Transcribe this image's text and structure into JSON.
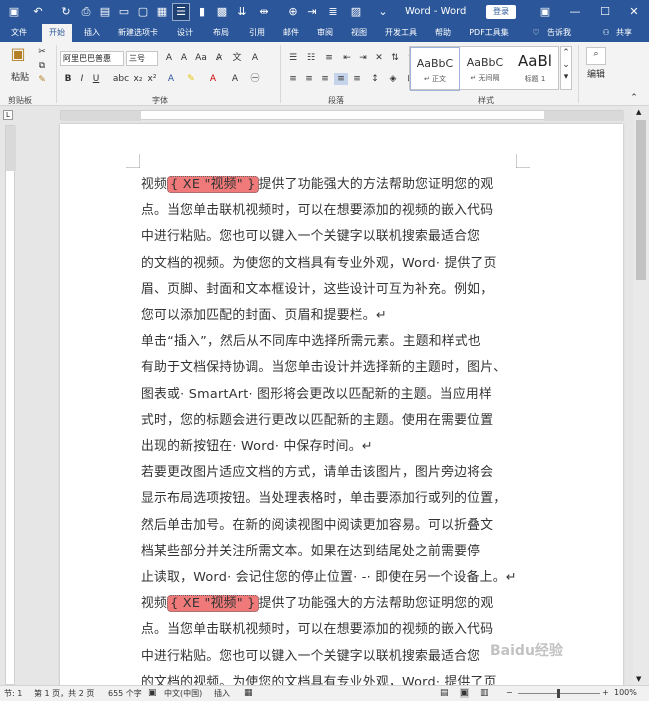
{
  "titlebar": {
    "title": "Word - Word",
    "login_label": "登录",
    "colors": {
      "brand": "#2b579a"
    }
  },
  "tabs": [
    "文件",
    "开始",
    "插入",
    "新建选项卡",
    "设计",
    "布局",
    "引用",
    "邮件",
    "审阅",
    "视图",
    "开发工具",
    "帮助",
    "PDF工具集"
  ],
  "active_tab": "开始",
  "tellme": "告诉我",
  "share": "共享",
  "ribbon": {
    "paste_label": "粘贴",
    "font_name": "阿里巴巴普惠",
    "font_size": "三号",
    "groups": {
      "clipboard": "剪贴板",
      "font": "字体",
      "paragraph": "段落",
      "styles": "样式",
      "edit": "编辑"
    },
    "styles": [
      {
        "preview": "AaBbC",
        "name": "↵ 正文"
      },
      {
        "preview": "AaBbC",
        "name": "↵ 无间隔"
      },
      {
        "preview": "AaBl",
        "name": "标题 1"
      }
    ]
  },
  "document": {
    "xe_field": "{ XE \"视频\" }",
    "lines": [
      "视频",
      "提供了功能强大的方法帮助您证明您的观",
      "点。当您单击联机视频时，可以在想要添加的视频的嵌入代码",
      "中进行粘贴。您也可以键入一个关键字以联机搜索最适合您",
      "的文档的视频。为使您的文档具有专业外观，Word· 提供了页",
      "眉、页脚、封面和文本框设计，这些设计可互为补充。例如，",
      "您可以添加匹配的封面、页眉和提要栏。↵",
      "单击“插入”，然后从不同库中选择所需元素。主题和样式也",
      "有助于文档保持协调。当您单击设计并选择新的主题时，图片、",
      "图表或· SmartArt· 图形将会更改以匹配新的主题。当应用样",
      "式时，您的标题会进行更改以匹配新的主题。使用在需要位置",
      "出现的新按钮在· Word· 中保存时间。↵",
      "若要更改图片适应文档的方式，请单击该图片，图片旁边将会",
      "显示布局选项按钮。当处理表格时，单击要添加行或列的位置，",
      "然后单击加号。在新的阅读视图中阅读更加容易。可以折叠文",
      "档某些部分并关注所需文本。如果在达到结尾处之前需要停",
      "止读取，Word· 会记住您的停止位置· -· 即使在另一个设备上。↵",
      "视频",
      "提供了功能强大的方法帮助您证明您的观",
      "点。当您单击联机视频时，可以在想要添加的视频的嵌入代码",
      "中进行粘贴。您也可以键入一个关键字以联机搜索最适合您",
      "的文档的视频。为使您的文档具有专业外观，Word· 提供了页"
    ],
    "colors": {
      "xe_highlight": "#f07a7a"
    }
  },
  "statusbar": {
    "section": "节: 1",
    "page": "第 1 页，共 2 页",
    "words": "655 个字",
    "language": "中文(中国)",
    "mode": "插入",
    "zoom": "100%"
  },
  "watermark": "Baidu经验"
}
